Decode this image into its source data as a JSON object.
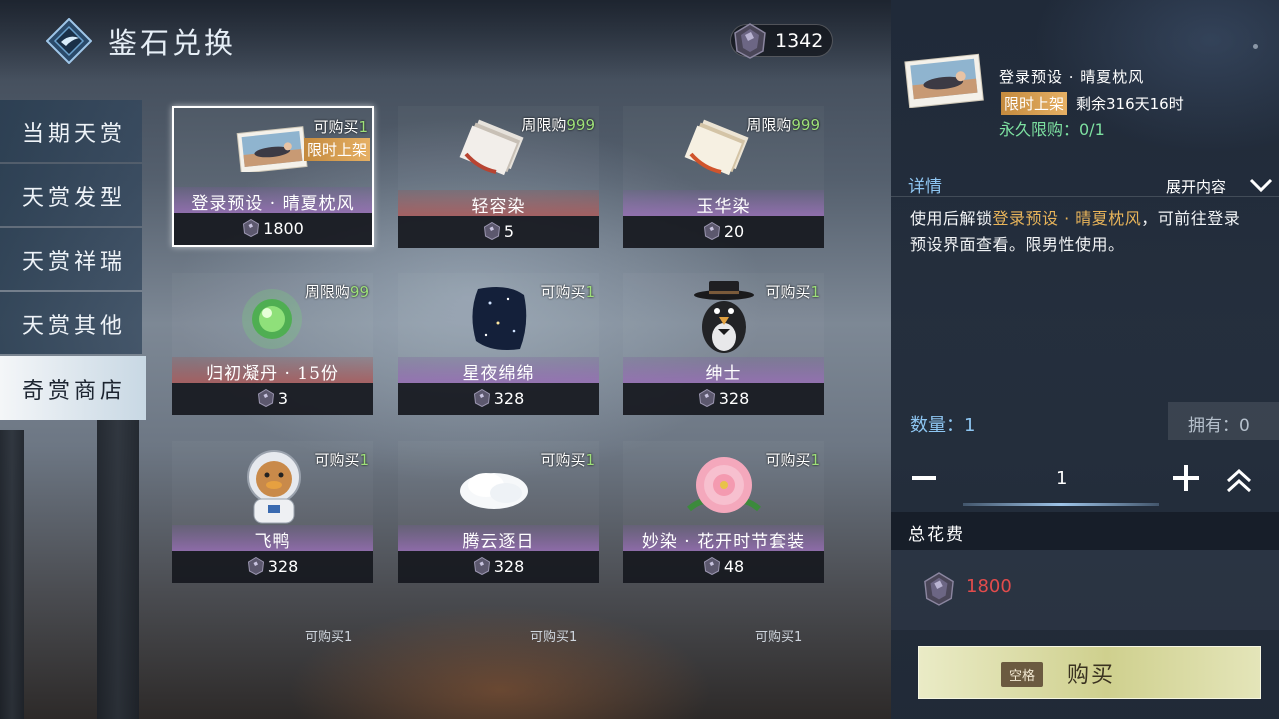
{
  "header": {
    "title": "鉴石兑换",
    "currency_icon": "gem-icon",
    "currency_amount": "1342"
  },
  "tabs": [
    {
      "label": "当期天赏",
      "active": false
    },
    {
      "label": "天赏发型",
      "active": false
    },
    {
      "label": "天赏祥瑞",
      "active": false
    },
    {
      "label": "天赏其他",
      "active": false
    },
    {
      "label": "奇赏商店",
      "active": true
    }
  ],
  "items": [
    {
      "name": "登录预设 · 晴夏枕风",
      "limit_text": "可购买",
      "limit_num": "1",
      "tag": "限时上架",
      "price": "1800",
      "selected": true,
      "icon": "photo-card-icon"
    },
    {
      "name": "轻容染",
      "limit_text": "周限购",
      "limit_num": "999",
      "price": "5",
      "icon": "dye-red-icon"
    },
    {
      "name": "玉华染",
      "limit_text": "周限购",
      "limit_num": "999",
      "price": "20",
      "icon": "dye-orange-icon"
    },
    {
      "name": "归初凝丹 · 15份",
      "limit_text": "周限购",
      "limit_num": "99",
      "price": "3",
      "icon": "green-orb-icon"
    },
    {
      "name": "星夜绵绵",
      "limit_text": "可购买",
      "limit_num": "1",
      "price": "328",
      "icon": "starry-night-icon"
    },
    {
      "name": "绅士",
      "limit_text": "可购买",
      "limit_num": "1",
      "price": "328",
      "icon": "gentleman-bird-icon"
    },
    {
      "name": "飞鸭",
      "limit_text": "可购买",
      "limit_num": "1",
      "price": "328",
      "icon": "astronaut-duck-icon"
    },
    {
      "name": "腾云逐日",
      "limit_text": "可购买",
      "limit_num": "1",
      "price": "328",
      "icon": "cloud-icon"
    },
    {
      "name": "妙染 · 花开时节套装",
      "limit_text": "可购买",
      "limit_num": "1",
      "price": "48",
      "icon": "peony-icon"
    }
  ],
  "peek_labels": [
    "可购买1",
    "可购买1",
    "可购买1"
  ],
  "detail": {
    "item_name": "登录预设 · 晴夏枕风",
    "tag": "限时上架",
    "remaining": "剩余316天16时",
    "perm_limit": "永久限购：0/1",
    "section_title": "详情",
    "expand_label": "展开内容",
    "desc_pre": "使用后解锁",
    "desc_highlight": "登录预设 · 晴夏枕风",
    "desc_post": "，可前往登录预设界面查看。限男性使用。",
    "quantity_label": "数量：1",
    "owned_label": "拥有：0",
    "quantity_value": "1",
    "total_cost_label": "总花费",
    "total_cost": "1800",
    "buy_key": "空格",
    "buy_label": "购买"
  },
  "colors": {
    "accent_gold": "#e6b064",
    "limit_green": "#9ee07a",
    "cost_red": "#e24c4c",
    "detail_blue": "#8ec6f2"
  }
}
